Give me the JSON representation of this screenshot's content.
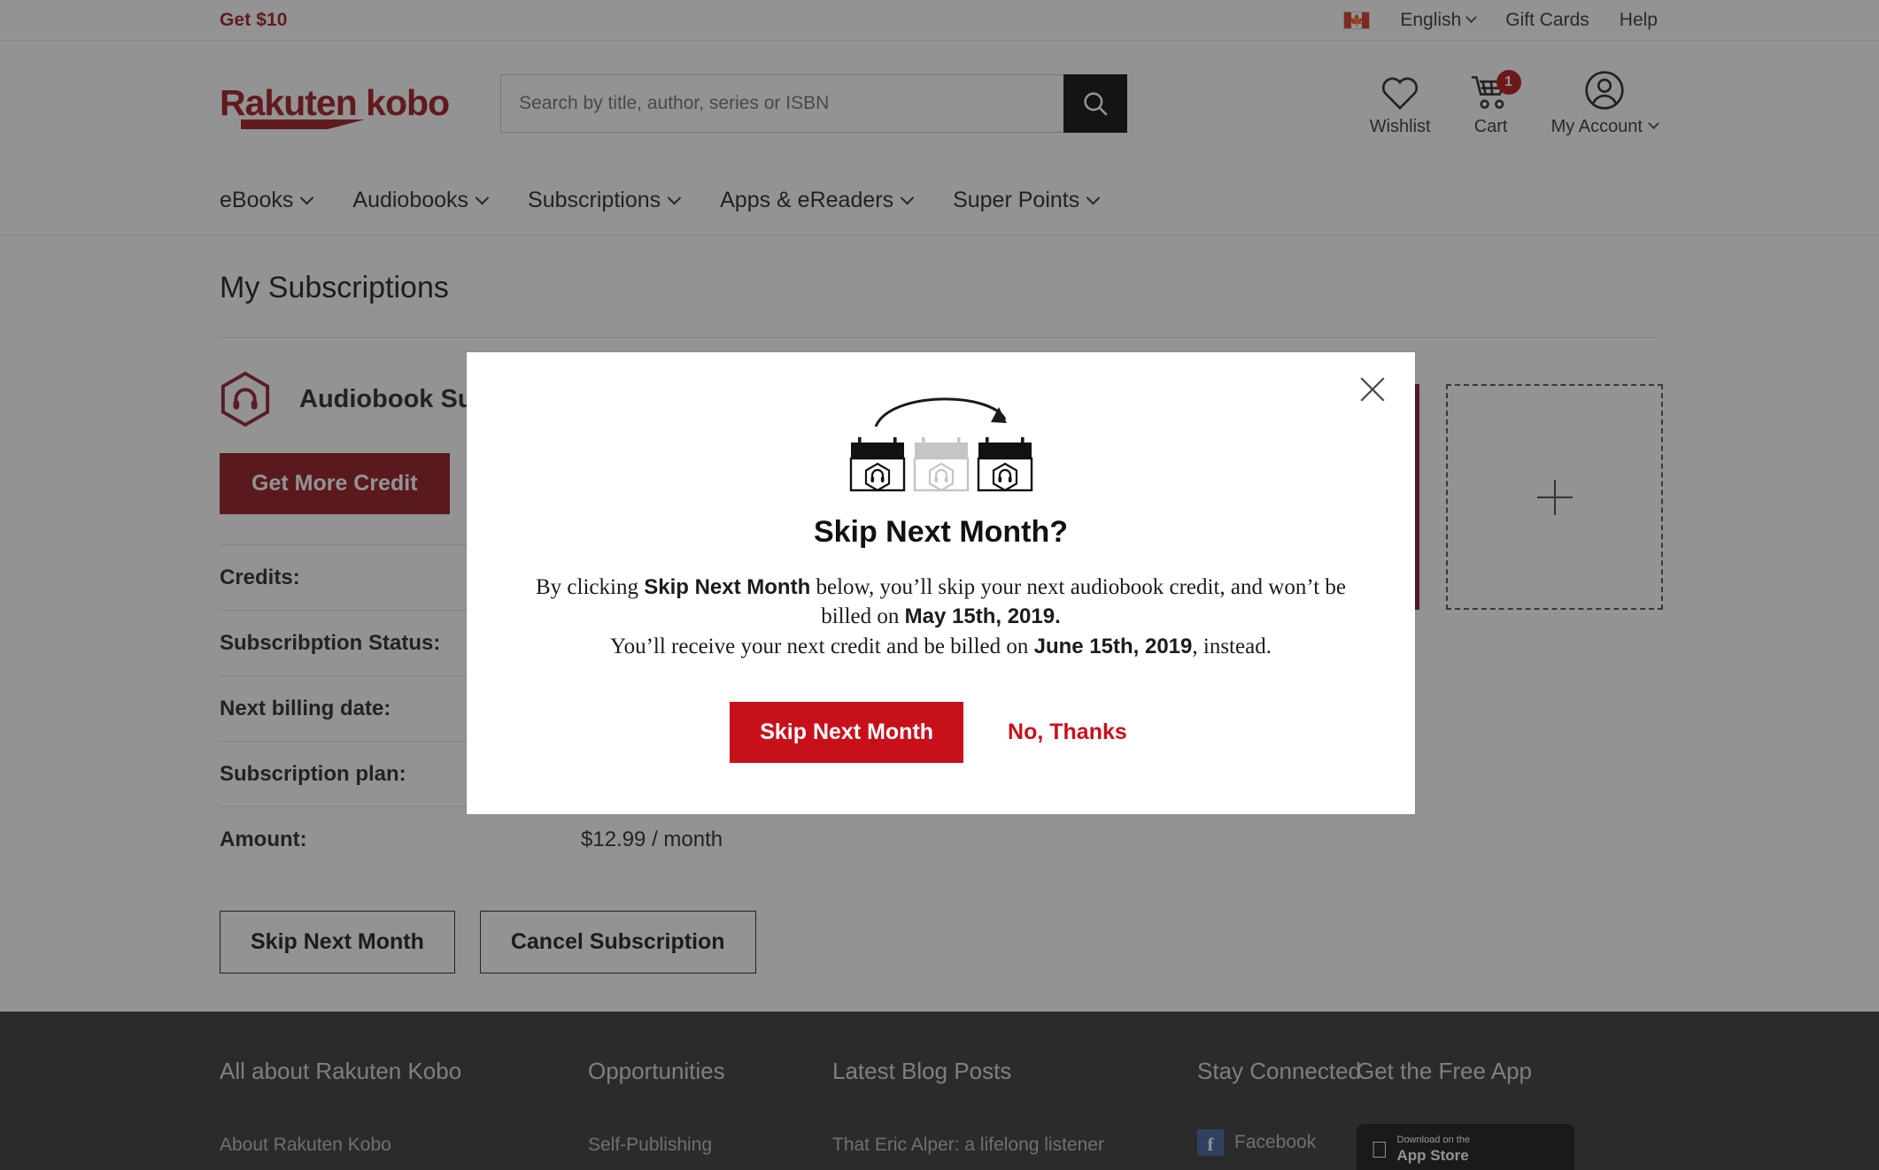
{
  "colors": {
    "brand_red": "#9b0d14",
    "modal_red": "#C8101B",
    "dark_red_button": "#8b0a12",
    "overlay": "#808080",
    "footer_bg": "#2f2f2f"
  },
  "utility_bar": {
    "get_10": "Get $10",
    "language": "English",
    "gift_cards": "Gift Cards",
    "help": "Help",
    "flag_icon": "canada-flag-icon"
  },
  "header": {
    "logo_primary": "Rakuten",
    "logo_secondary": "kobo",
    "search_placeholder": "Search by title, author, series or ISBN",
    "search_value": "",
    "search_icon": "search-icon",
    "wishlist_label": "Wishlist",
    "cart_label": "Cart",
    "cart_count": "1",
    "account_label": "My Account"
  },
  "nav": {
    "items": [
      {
        "label": "eBooks"
      },
      {
        "label": "Audiobooks"
      },
      {
        "label": "Subscriptions"
      },
      {
        "label": "Apps & eReaders"
      },
      {
        "label": "Super Points"
      }
    ]
  },
  "main": {
    "page_title": "My Subscriptions",
    "subscription_name": "Audiobook Subscription",
    "get_more_credit": "Get More Credit",
    "info_rows": [
      {
        "label": "Credits:",
        "value": ""
      },
      {
        "label": "Subscribption Status:",
        "value": ""
      },
      {
        "label": "Next billing date:",
        "value": ""
      },
      {
        "label": "Subscription plan:",
        "value": ""
      },
      {
        "label": "Amount:",
        "value": "$12.99 / month"
      }
    ],
    "skip_next_month": "Skip Next Month",
    "cancel_subscription": "Cancel Subscription"
  },
  "modal": {
    "close_icon": "close-icon",
    "illustration": "calendar-skip-month-icon",
    "title": "Skip Next Month?",
    "line1_a": "By clicking ",
    "line1_b": "Skip Next Month",
    "line1_c": " below, you’ll skip your next audiobook credit, and won’t be billed on ",
    "line1_d": "May 15th, 2019.",
    "line2_a": "You’ll receive your next credit and be billed on ",
    "line2_b": "June 15th, 2019",
    "line2_c": ", instead.",
    "primary_button": "Skip Next Month",
    "secondary_button": "No, Thanks"
  },
  "footer": {
    "columns": [
      {
        "title": "All about Rakuten Kobo",
        "link": "About Rakuten Kobo"
      },
      {
        "title": "Opportunities",
        "link": "Self-Publishing"
      },
      {
        "title": "Latest Blog Posts",
        "link": "That Eric Alper: a lifelong listener"
      },
      {
        "title": "Stay Connected",
        "link": "Facebook"
      },
      {
        "title": "Get the Free App",
        "link": ""
      }
    ],
    "app_badge_small": "Download on the",
    "app_badge_big": "App Store"
  }
}
